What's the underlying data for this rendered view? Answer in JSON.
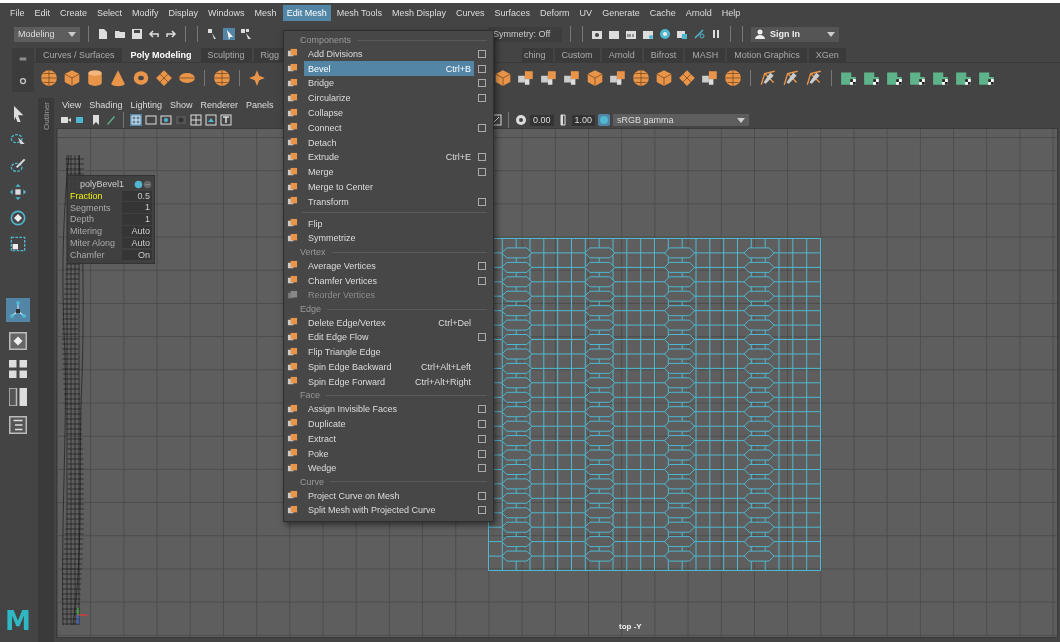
{
  "menu_bar": [
    {
      "label": "File",
      "selected": false
    },
    {
      "label": "Edit",
      "selected": false
    },
    {
      "label": "Create",
      "selected": false
    },
    {
      "label": "Select",
      "selected": false
    },
    {
      "label": "Modify",
      "selected": false
    },
    {
      "label": "Display",
      "selected": false
    },
    {
      "label": "Windows",
      "selected": false
    },
    {
      "label": "Mesh",
      "selected": false
    },
    {
      "label": "Edit Mesh",
      "selected": true
    },
    {
      "label": "Mesh Tools",
      "selected": false
    },
    {
      "label": "Mesh Display",
      "selected": false
    },
    {
      "label": "Curves",
      "selected": false
    },
    {
      "label": "Surfaces",
      "selected": false
    },
    {
      "label": "Deform",
      "selected": false
    },
    {
      "label": "UV",
      "selected": false
    },
    {
      "label": "Generate",
      "selected": false
    },
    {
      "label": "Cache",
      "selected": false
    },
    {
      "label": "Arnold",
      "selected": false
    },
    {
      "label": "Help",
      "selected": false
    }
  ],
  "status_line": {
    "workspace": "Modeling",
    "symmetry": "Symmetry: Off",
    "sign_in": "Sign In"
  },
  "shelf": {
    "tabs": [
      {
        "label": "Curves / Surfaces",
        "selected": false
      },
      {
        "label": "Poly Modeling",
        "selected": true
      },
      {
        "label": "Sculpting",
        "selected": false
      },
      {
        "label": "Rigg",
        "selected": false
      },
      {
        "label": "ching",
        "selected": false
      },
      {
        "label": "Custom",
        "selected": false
      },
      {
        "label": "Arnold",
        "selected": false
      },
      {
        "label": "Bifrost",
        "selected": false
      },
      {
        "label": "MASH",
        "selected": false
      },
      {
        "label": "Motion Graphics",
        "selected": false
      },
      {
        "label": "XGen",
        "selected": false
      }
    ]
  },
  "outliner_tab": "Outliner",
  "viewport": {
    "menu": [
      "View",
      "Shading",
      "Lighting",
      "Show",
      "Renderer",
      "Panels"
    ],
    "exposure": "0.00",
    "gamma": "1.00",
    "color_space": "sRGB gamma",
    "camera_label": "top -Y"
  },
  "hud": {
    "title": "polyBevel1",
    "rows": [
      {
        "label": "Fraction",
        "value": "0.5",
        "highlighted": true
      },
      {
        "label": "Segments",
        "value": "1",
        "highlighted": false
      },
      {
        "label": "Depth",
        "value": "1",
        "highlighted": false
      },
      {
        "label": "Mitering",
        "value": "Auto",
        "highlighted": false
      },
      {
        "label": "Miter Along",
        "value": "Auto",
        "highlighted": false
      },
      {
        "label": "Chamfer",
        "value": "On",
        "highlighted": false
      }
    ]
  },
  "edit_mesh_menu": {
    "sections": [
      {
        "header": "Components",
        "items": [
          {
            "label": "Add Divisions",
            "option_box": true,
            "selected": false,
            "disabled": false
          },
          {
            "label": "Bevel",
            "shortcut": "Ctrl+B",
            "option_box": true,
            "selected": true,
            "disabled": false
          },
          {
            "label": "Bridge",
            "option_box": true,
            "selected": false,
            "disabled": false
          },
          {
            "label": "Circularize",
            "option_box": true,
            "selected": false,
            "disabled": false
          },
          {
            "label": "Collapse",
            "option_box": false,
            "selected": false,
            "disabled": false
          },
          {
            "label": "Connect",
            "option_box": true,
            "selected": false,
            "disabled": false
          },
          {
            "label": "Detach",
            "option_box": false,
            "selected": false,
            "disabled": false
          },
          {
            "label": "Extrude",
            "shortcut": "Ctrl+E",
            "option_box": true,
            "selected": false,
            "disabled": false
          },
          {
            "label": "Merge",
            "option_box": true,
            "selected": false,
            "disabled": false
          },
          {
            "label": "Merge to Center",
            "option_box": false,
            "selected": false,
            "disabled": false
          },
          {
            "label": "Transform",
            "option_box": true,
            "selected": false,
            "disabled": false
          }
        ]
      },
      {
        "items": [
          {
            "label": "Flip",
            "option_box": false,
            "selected": false,
            "disabled": false
          },
          {
            "label": "Symmetrize",
            "option_box": false,
            "selected": false,
            "disabled": false
          }
        ]
      },
      {
        "header": "Vertex",
        "items": [
          {
            "label": "Average Vertices",
            "option_box": true,
            "selected": false,
            "disabled": false
          },
          {
            "label": "Chamfer Vertices",
            "option_box": true,
            "selected": false,
            "disabled": false
          },
          {
            "label": "Reorder Vertices",
            "option_box": false,
            "selected": false,
            "disabled": true
          }
        ]
      },
      {
        "header": "Edge",
        "items": [
          {
            "label": "Delete Edge/Vertex",
            "shortcut": "Ctrl+Del",
            "option_box": false,
            "selected": false,
            "disabled": false
          },
          {
            "label": "Edit Edge Flow",
            "option_box": true,
            "selected": false,
            "disabled": false
          },
          {
            "label": "Flip Triangle Edge",
            "option_box": false,
            "selected": false,
            "disabled": false
          },
          {
            "label": "Spin Edge Backward",
            "shortcut": "Ctrl+Alt+Left",
            "option_box": false,
            "selected": false,
            "disabled": false
          },
          {
            "label": "Spin Edge Forward",
            "shortcut": "Ctrl+Alt+Right",
            "option_box": false,
            "selected": false,
            "disabled": false
          }
        ]
      },
      {
        "header": "Face",
        "items": [
          {
            "label": "Assign Invisible Faces",
            "option_box": true,
            "selected": false,
            "disabled": false
          },
          {
            "label": "Duplicate",
            "option_box": true,
            "selected": false,
            "disabled": false
          },
          {
            "label": "Extract",
            "option_box": true,
            "selected": false,
            "disabled": false
          },
          {
            "label": "Poke",
            "option_box": true,
            "selected": false,
            "disabled": false
          },
          {
            "label": "Wedge",
            "option_box": true,
            "selected": false,
            "disabled": false
          }
        ]
      },
      {
        "header": "Curve",
        "items": [
          {
            "label": "Project Curve on Mesh",
            "option_box": true,
            "selected": false,
            "disabled": false
          },
          {
            "label": "Split Mesh with Projected Curve",
            "option_box": true,
            "selected": false,
            "disabled": false
          }
        ]
      }
    ]
  },
  "logo": "M"
}
